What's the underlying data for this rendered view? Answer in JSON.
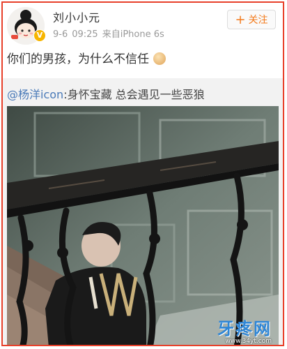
{
  "post": {
    "username": "刘小小元",
    "date": "9-6",
    "time": "09:25",
    "source": "来自iPhone 6s",
    "follow_label": "关注",
    "text": "你们的男孩，为什么不信任",
    "emoji_icon": "cat-head-emoji-icon"
  },
  "repost": {
    "mention": "@杨洋icon",
    "text": ":身怀宝藏 总会遇见一些恶狼"
  },
  "watermark": {
    "name": "牙疼网",
    "url": "www.34yt.com"
  },
  "colors": {
    "border": "#e8402a",
    "follow": "#f37b1d",
    "mention": "#4a7ab8",
    "watermark": "#2f86d6"
  }
}
